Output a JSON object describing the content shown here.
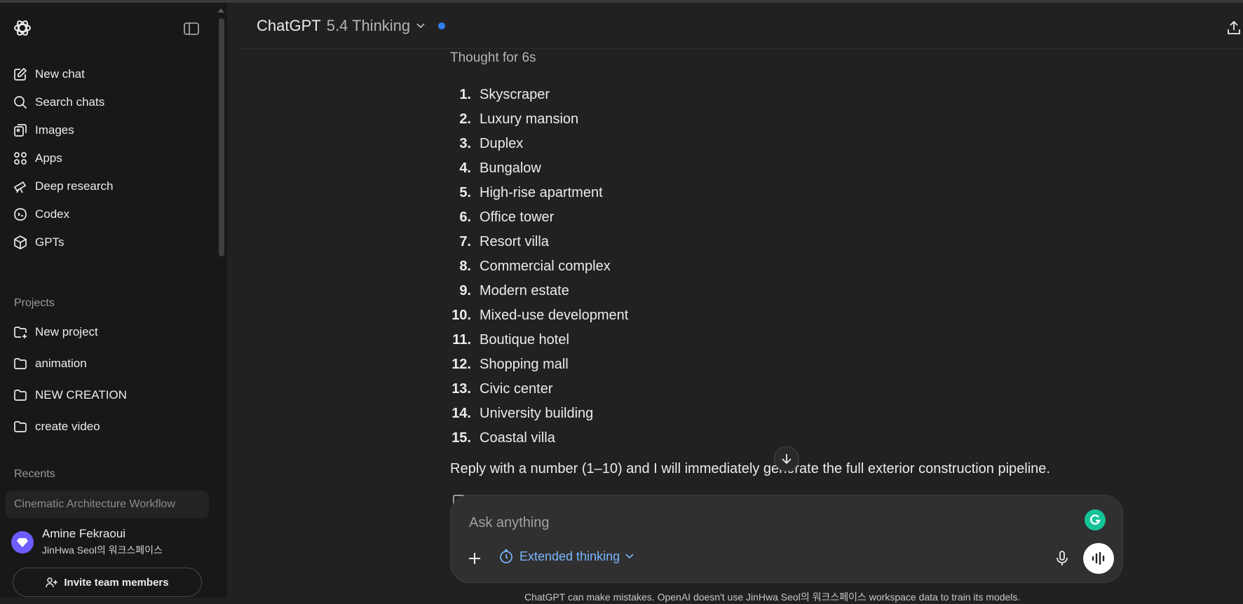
{
  "sidebar": {
    "nav": [
      {
        "label": "New chat",
        "icon": "pencil-square-icon"
      },
      {
        "label": "Search chats",
        "icon": "search-icon"
      },
      {
        "label": "Images",
        "icon": "images-icon"
      },
      {
        "label": "Apps",
        "icon": "apps-grid-icon"
      },
      {
        "label": "Deep research",
        "icon": "telescope-icon"
      },
      {
        "label": "Codex",
        "icon": "codex-icon"
      },
      {
        "label": "GPTs",
        "icon": "cube-icon"
      }
    ],
    "projects_label": "Projects",
    "projects": [
      {
        "label": "New project",
        "icon": "folder-plus-icon"
      },
      {
        "label": "animation",
        "icon": "folder-icon"
      },
      {
        "label": "NEW CREATION",
        "icon": "folder-icon"
      },
      {
        "label": "create video",
        "icon": "folder-icon"
      }
    ],
    "recents_label": "Recents",
    "recents": [
      "Cinematic Architecture Workflow"
    ],
    "user": {
      "name": "Amine Fekraoui",
      "workspace": "JinHwa Seol의 워크스페이스"
    },
    "invite_label": "Invite team members"
  },
  "header": {
    "model_name": "ChatGPT",
    "model_version": "5.4 Thinking"
  },
  "chat": {
    "thought": "Thought for 6s",
    "items": [
      {
        "n": "1.",
        "text": "Skyscraper"
      },
      {
        "n": "2.",
        "text": "Luxury mansion"
      },
      {
        "n": "3.",
        "text": "Duplex"
      },
      {
        "n": "4.",
        "text": "Bungalow"
      },
      {
        "n": "5.",
        "text": "High-rise apartment"
      },
      {
        "n": "6.",
        "text": "Office tower"
      },
      {
        "n": "7.",
        "text": "Resort villa"
      },
      {
        "n": "8.",
        "text": "Commercial complex"
      },
      {
        "n": "9.",
        "text": "Modern estate"
      },
      {
        "n": "10.",
        "text": "Mixed-use development"
      },
      {
        "n": "11.",
        "text": "Boutique hotel"
      },
      {
        "n": "12.",
        "text": "Shopping mall"
      },
      {
        "n": "13.",
        "text": "Civic center"
      },
      {
        "n": "14.",
        "text": "University building"
      },
      {
        "n": "15.",
        "text": "Coastal villa"
      }
    ],
    "reply": "Reply with a number (1–10) and I will immediately generate the full exterior construction pipeline."
  },
  "composer": {
    "placeholder": "Ask anything",
    "mode_label": "Extended thinking"
  },
  "disclaimer": "ChatGPT can make mistakes. OpenAI doesn't use JinHwa Seol의 워크스페이스 workspace data to train its models.",
  "colors": {
    "background": "#212121",
    "sidebar": "#181818",
    "accent": "#7ab7ff",
    "status_dot": "#2f80ed"
  }
}
